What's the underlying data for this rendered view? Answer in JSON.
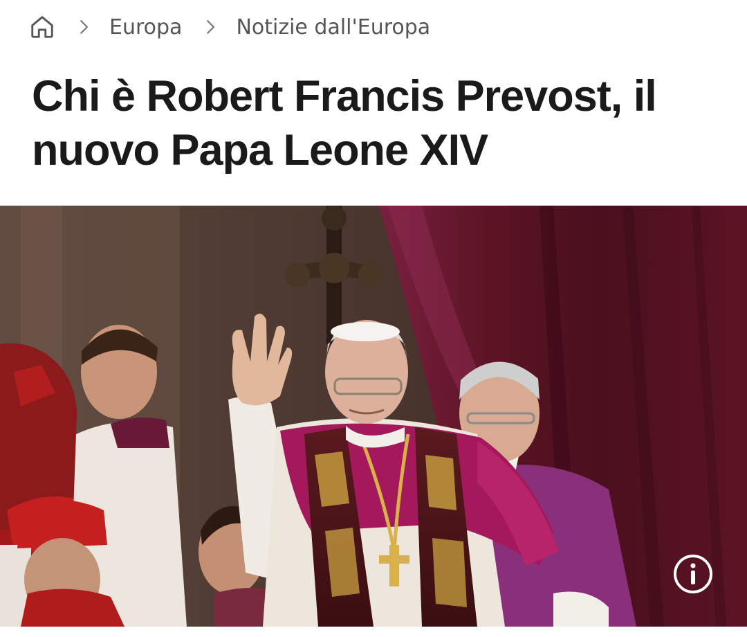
{
  "breadcrumb": {
    "home_icon": "home-icon",
    "separator_icon": "chevron-right-icon",
    "items": [
      {
        "label": "Europa"
      },
      {
        "label": "Notizie dall'Europa"
      }
    ]
  },
  "article": {
    "title": "Chi è Robert Francis Prevost, il nuovo Papa Leone XIV"
  },
  "hero_image": {
    "info_icon": "info-icon"
  },
  "colors": {
    "text": "#1a1a1a",
    "breadcrumb": "#555555",
    "curtain": "#5c1424",
    "vestment_magenta": "#a3195b",
    "cassock_purple": "#8a2f7a"
  }
}
